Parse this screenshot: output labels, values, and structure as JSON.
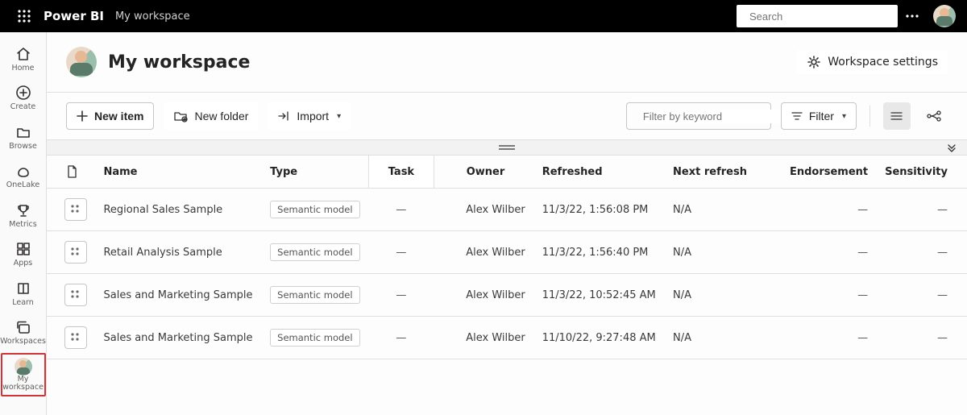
{
  "top": {
    "brand": "Power BI",
    "breadcrumb": "My workspace",
    "search_placeholder": "Search"
  },
  "rail": {
    "items": [
      {
        "label": "Home"
      },
      {
        "label": "Create"
      },
      {
        "label": "Browse"
      },
      {
        "label": "OneLake"
      },
      {
        "label": "Metrics"
      },
      {
        "label": "Apps"
      },
      {
        "label": "Learn"
      },
      {
        "label": "Workspaces"
      },
      {
        "label": "My workspace"
      }
    ]
  },
  "page": {
    "title": "My workspace",
    "settings_label": "Workspace settings"
  },
  "toolbar": {
    "new_item": "New item",
    "new_folder": "New folder",
    "import": "Import",
    "filter_placeholder": "Filter by keyword",
    "filter_button": "Filter"
  },
  "table": {
    "columns": {
      "name": "Name",
      "type": "Type",
      "task": "Task",
      "owner": "Owner",
      "refreshed": "Refreshed",
      "next_refresh": "Next refresh",
      "endorsement": "Endorsement",
      "sensitivity": "Sensitivity"
    },
    "rows": [
      {
        "name": "Regional Sales Sample",
        "type": "Semantic model",
        "task": "—",
        "owner": "Alex Wilber",
        "refreshed": "11/3/22, 1:56:08 PM",
        "next_refresh": "N/A",
        "endorsement": "—",
        "sensitivity": "—"
      },
      {
        "name": "Retail Analysis Sample",
        "type": "Semantic model",
        "task": "—",
        "owner": "Alex Wilber",
        "refreshed": "11/3/22, 1:56:40 PM",
        "next_refresh": "N/A",
        "endorsement": "—",
        "sensitivity": "—"
      },
      {
        "name": "Sales and Marketing Sample",
        "type": "Semantic model",
        "task": "—",
        "owner": "Alex Wilber",
        "refreshed": "11/3/22, 10:52:45 AM",
        "next_refresh": "N/A",
        "endorsement": "—",
        "sensitivity": "—"
      },
      {
        "name": "Sales and Marketing Sample",
        "type": "Semantic model",
        "task": "—",
        "owner": "Alex Wilber",
        "refreshed": "11/10/22, 9:27:48 AM",
        "next_refresh": "N/A",
        "endorsement": "—",
        "sensitivity": "—"
      }
    ]
  }
}
